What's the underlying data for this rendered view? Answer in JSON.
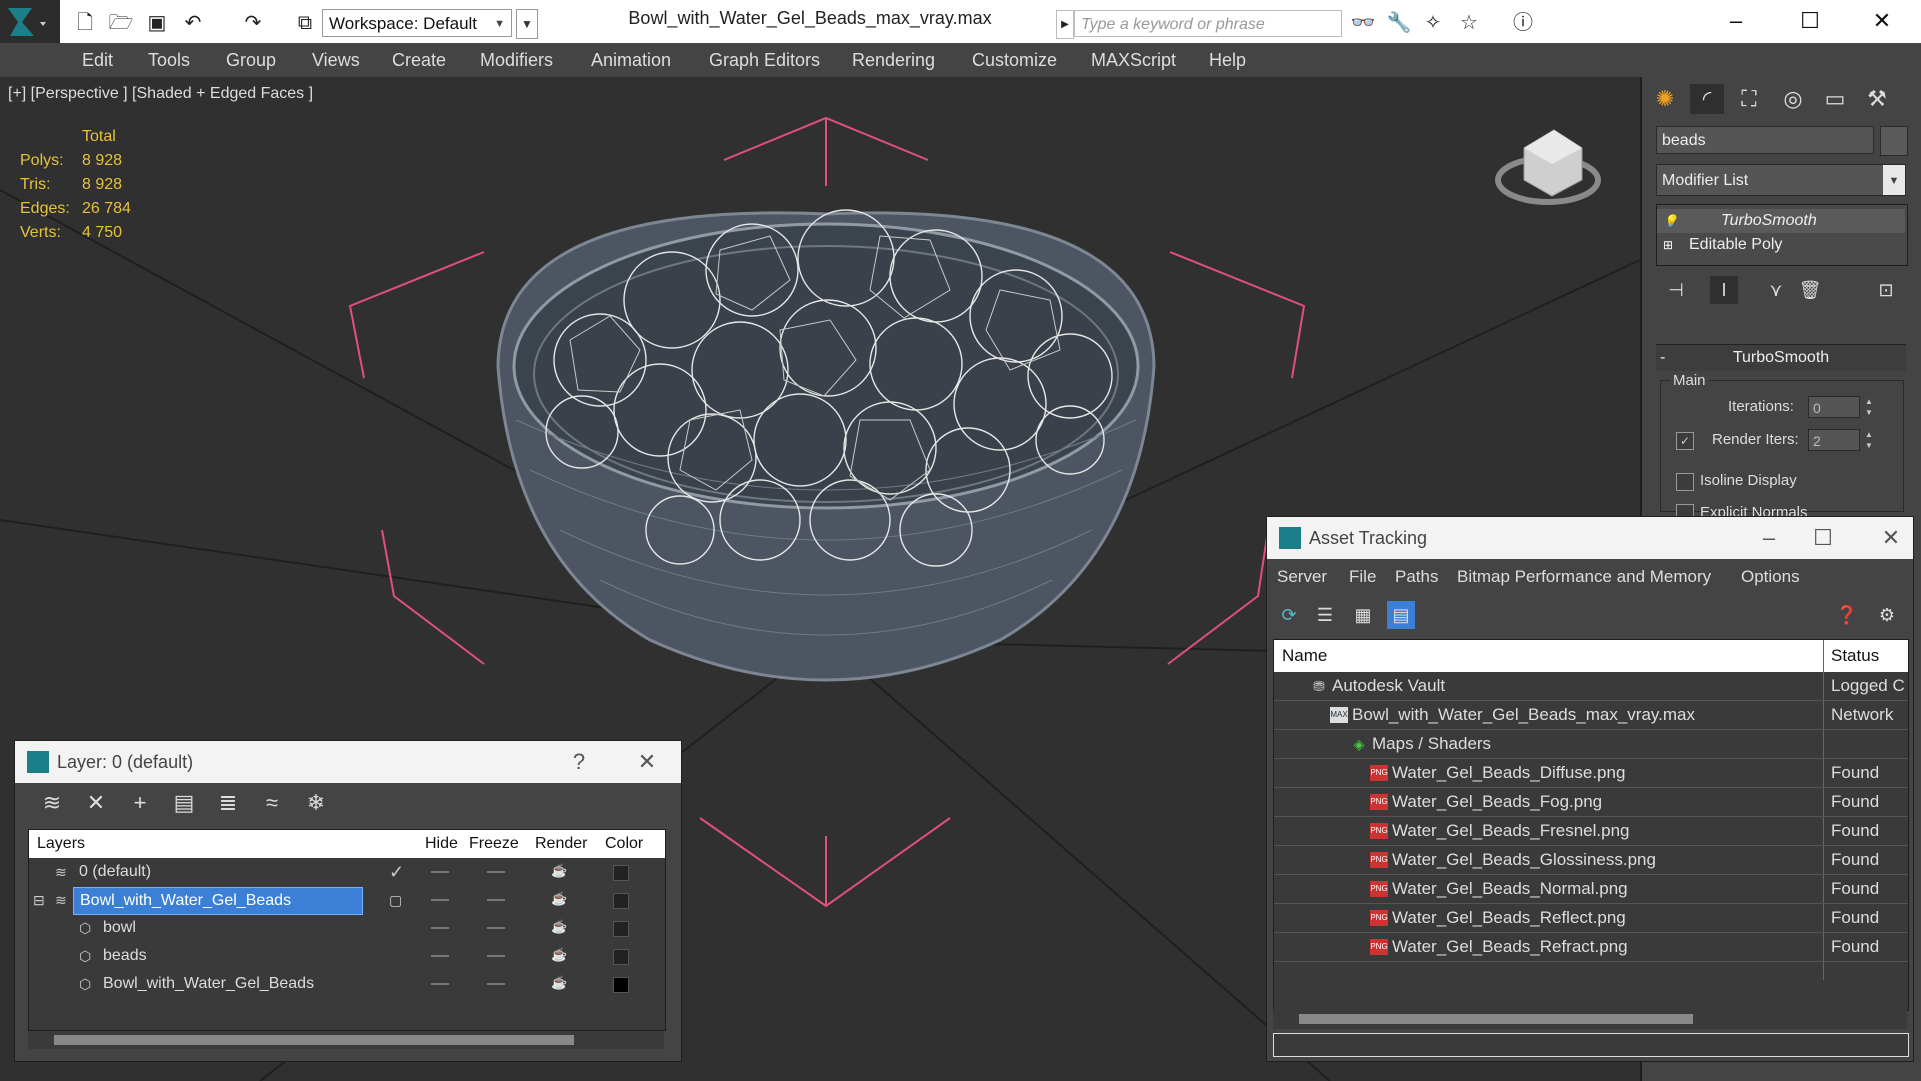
{
  "app": {
    "title": "Bowl_with_Water_Gel_Beads_max_vray.max",
    "workspace": "Workspace: Default",
    "search_placeholder": "Type a keyword or phrase",
    "window_controls": [
      "minimize-icon",
      "maximize-icon",
      "close-icon"
    ]
  },
  "toolbar": {
    "icons": [
      "new-file-icon",
      "open-file-icon",
      "save-icon",
      "undo-icon",
      "redo-icon",
      "project-icon"
    ],
    "search_icons": [
      "binoculars-icon",
      "tools-icon",
      "star-sign-in-icon",
      "favorite-icon",
      "help-icon"
    ]
  },
  "menu": [
    "Edit",
    "Tools",
    "Group",
    "Views",
    "Create",
    "Modifiers",
    "Animation",
    "Graph Editors",
    "Rendering",
    "Customize",
    "MAXScript",
    "Help"
  ],
  "viewport": {
    "label": "[+] [Perspective ] [Shaded + Edged Faces ]",
    "stats_header": "Total",
    "stats": [
      {
        "label": "Polys:",
        "value": "8 928"
      },
      {
        "label": "Tris:",
        "value": "8 928"
      },
      {
        "label": "Edges:",
        "value": "26 784"
      },
      {
        "label": "Verts:",
        "value": "4 750"
      }
    ]
  },
  "command_panel": {
    "tabs": [
      "create-icon",
      "modify-icon",
      "hierarchy-icon",
      "motion-icon",
      "display-icon",
      "utilities-icon"
    ],
    "object_name": "beads",
    "modifier_list": "Modifier List",
    "stack": [
      {
        "name": "TurboSmooth",
        "icon": "bulb-icon"
      },
      {
        "name": "Editable Poly",
        "icon": "plus-icon"
      }
    ],
    "rollout_title": "TurboSmooth",
    "group_title": "Main",
    "iterations_label": "Iterations:",
    "iterations_value": "0",
    "render_iters_label": "Render Iters:",
    "render_iters_value": "2",
    "isoline_label": "Isoline Display",
    "explicit_label": "Explicit Normals"
  },
  "layer_window": {
    "title": "Layer: 0 (default)",
    "help": "?",
    "tools": [
      "new-layer-icon",
      "delete-icon",
      "add-icon",
      "select-icon",
      "highlight-icon",
      "hide-icon",
      "freeze-icon"
    ],
    "columns": [
      "Layers",
      "Hide",
      "Freeze",
      "Render",
      "Color"
    ],
    "rows": [
      {
        "name": "0 (default)",
        "current": true,
        "selected": false
      },
      {
        "name": "Bowl_with_Water_Gel_Beads",
        "current": false,
        "selected": true
      },
      {
        "name": "bowl",
        "current": false,
        "selected": false
      },
      {
        "name": "beads",
        "current": false,
        "selected": false
      },
      {
        "name": "Bowl_with_Water_Gel_Beads",
        "current": false,
        "selected": false
      }
    ]
  },
  "asset_window": {
    "title": "Asset Tracking",
    "menu": [
      "Server",
      "File",
      "Paths",
      "Bitmap Performance and Memory",
      "Options"
    ],
    "columns": [
      "Name",
      "Status"
    ],
    "rows": [
      {
        "name": "Autodesk Vault",
        "status": "Logged C",
        "icon": "vault-icon"
      },
      {
        "name": "Bowl_with_Water_Gel_Beads_max_vray.max",
        "status": "Network",
        "icon": "max-file-icon"
      },
      {
        "name": "Maps / Shaders",
        "status": "",
        "icon": "maps-icon"
      },
      {
        "name": "Water_Gel_Beads_Diffuse.png",
        "status": "Found",
        "icon": "png-icon"
      },
      {
        "name": "Water_Gel_Beads_Fog.png",
        "status": "Found",
        "icon": "png-icon"
      },
      {
        "name": "Water_Gel_Beads_Fresnel.png",
        "status": "Found",
        "icon": "png-icon"
      },
      {
        "name": "Water_Gel_Beads_Glossiness.png",
        "status": "Found",
        "icon": "png-icon"
      },
      {
        "name": "Water_Gel_Beads_Normal.png",
        "status": "Found",
        "icon": "png-icon"
      },
      {
        "name": "Water_Gel_Beads_Reflect.png",
        "status": "Found",
        "icon": "png-icon"
      },
      {
        "name": "Water_Gel_Beads_Refract.png",
        "status": "Found",
        "icon": "png-icon"
      }
    ],
    "png_badge": "PNG",
    "max_badge": "MAX"
  },
  "colors": {
    "accent": "#3b7fd6",
    "stats": "#e6c23c",
    "bracket": "#e0507a"
  }
}
